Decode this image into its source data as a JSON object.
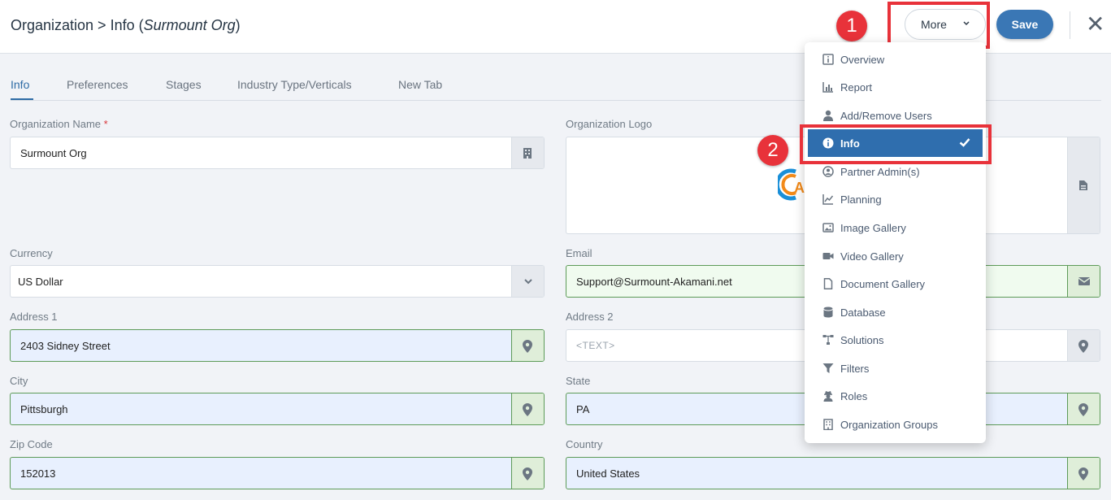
{
  "header": {
    "title_prefix": "Organization > Info (",
    "title_org": "Surmount Org",
    "title_suffix": ")",
    "more_label": "More",
    "save_label": "Save"
  },
  "callouts": [
    "1",
    "2"
  ],
  "tabs": [
    {
      "label": "Info",
      "active": true
    },
    {
      "label": "Preferences"
    },
    {
      "label": "Stages"
    },
    {
      "label": "Industry Type/Verticals"
    },
    {
      "label": "New Tab"
    }
  ],
  "form": {
    "org_name_label": "Organization Name",
    "org_name_required": "*",
    "org_name_value": "Surmount Org",
    "org_logo_label": "Organization Logo",
    "currency_label": "Currency",
    "currency_value": "US Dollar",
    "email_label": "Email",
    "email_value": "Support@Surmount-Akamani.net",
    "address1_label": "Address 1",
    "address1_value": "2403 Sidney Street",
    "address2_label": "Address 2",
    "address2_placeholder": "<TEXT>",
    "city_label": "City",
    "city_value": "Pittsburgh",
    "state_label": "State",
    "state_value": "PA",
    "zip_label": "Zip Code",
    "zip_value": "152013",
    "country_label": "Country",
    "country_value": "United States"
  },
  "menu": {
    "items": [
      {
        "label": "Overview",
        "icon": "info-square-icon"
      },
      {
        "label": "Report",
        "icon": "bar-chart-icon"
      },
      {
        "label": "Add/Remove Users",
        "icon": "user-icon"
      },
      {
        "label": "Info",
        "icon": "info-circle-icon",
        "selected": true
      },
      {
        "label": "Partner Admin(s)",
        "icon": "user-circle-icon"
      },
      {
        "label": "Planning",
        "icon": "line-chart-icon"
      },
      {
        "label": "Image Gallery",
        "icon": "image-icon"
      },
      {
        "label": "Video Gallery",
        "icon": "video-icon"
      },
      {
        "label": "Document Gallery",
        "icon": "document-icon"
      },
      {
        "label": "Database",
        "icon": "database-icon"
      },
      {
        "label": "Solutions",
        "icon": "sitemap-icon"
      },
      {
        "label": "Filters",
        "icon": "filter-icon"
      },
      {
        "label": "Roles",
        "icon": "user-secret-icon"
      },
      {
        "label": "Organization Groups",
        "icon": "building-icon"
      }
    ]
  },
  "colors": {
    "primary": "#2f6eae",
    "callout": "#e8323a",
    "valid_border": "#5d9b58",
    "required": "#d9383c"
  }
}
